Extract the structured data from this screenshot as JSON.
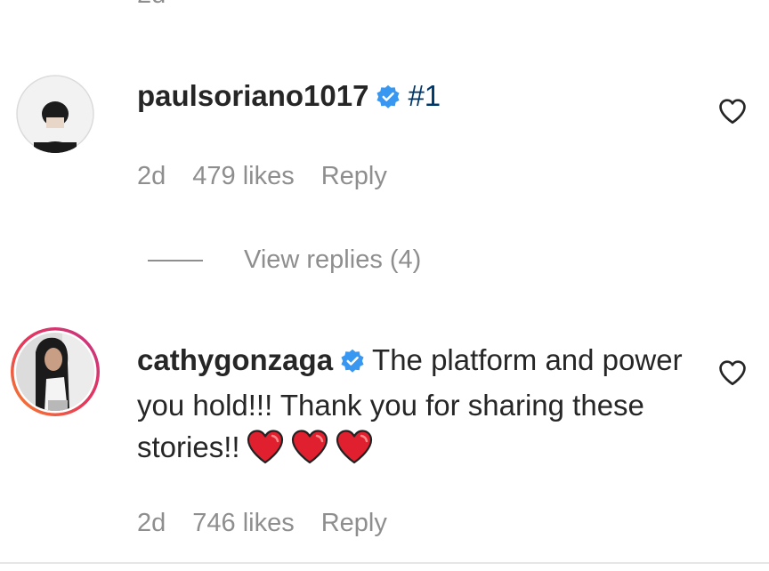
{
  "previous_comment": {
    "time_fragment": "2d"
  },
  "comments": [
    {
      "username": "paulsoriano1017",
      "verified": true,
      "text_mention": "#1",
      "text": "",
      "time": "2d",
      "likes": "479 likes",
      "reply_label": "Reply",
      "view_replies_label": "View replies (4)"
    },
    {
      "username": "cathygonzaga",
      "verified": true,
      "text_mention": "",
      "text": "The platform and power you hold!!! Thank you for sharing these stories!!",
      "emojis": [
        "red-heart",
        "red-heart",
        "red-heart"
      ],
      "time": "2d",
      "likes": "746 likes",
      "reply_label": "Reply"
    }
  ],
  "icons": {
    "verified": "verified-badge-icon",
    "like": "heart-outline-icon",
    "emoji": "red-heart-emoji"
  },
  "colors": {
    "verified_blue": "#3897f0",
    "mention_blue": "#00376b",
    "secondary_text": "#8e8e8e",
    "story_ring_start": "#f58529",
    "story_ring_end": "#dd2a7b",
    "heart_red": "#e0202e"
  }
}
